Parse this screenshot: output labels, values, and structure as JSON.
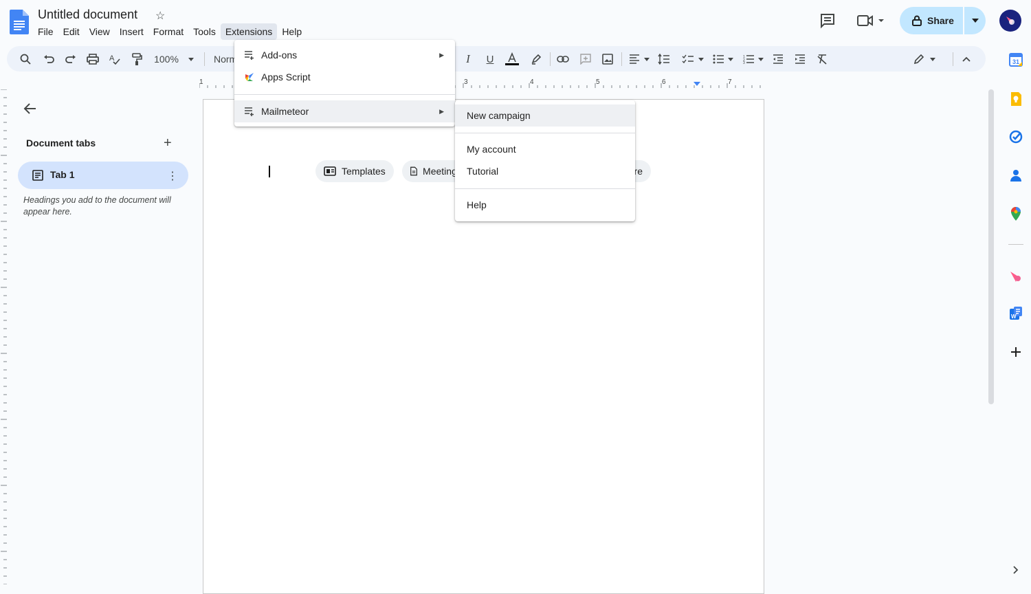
{
  "app": {
    "title": "Untitled document",
    "menus": [
      "File",
      "Edit",
      "View",
      "Insert",
      "Format",
      "Tools",
      "Extensions",
      "Help"
    ],
    "share_label": "Share"
  },
  "toolbar": {
    "zoom": "100%",
    "style": "Normal text"
  },
  "ruler": {
    "numbers": [
      "1",
      "1",
      "2",
      "3",
      "4",
      "5",
      "6",
      "7"
    ]
  },
  "left_panel": {
    "heading": "Document tabs",
    "tab_label": "Tab 1",
    "hint": "Headings you add to the document will appear here."
  },
  "chips": {
    "templates": "Templates",
    "meeting": "Meeting notes",
    "more": "More"
  },
  "extensions_menu": {
    "items": [
      {
        "label": "Add-ons",
        "icon": "addons-icon",
        "has_submenu": true
      },
      {
        "label": "Apps Script",
        "icon": "apps-script-icon",
        "has_submenu": false
      },
      {
        "label": "Mailmeteor",
        "icon": "addon-list-icon",
        "has_submenu": true
      }
    ]
  },
  "mailmeteor_submenu": {
    "items": [
      "New campaign",
      "My account",
      "Tutorial",
      "Help"
    ]
  },
  "colors": {
    "accent_blue": "#0b57d0",
    "share_bg": "#c2e7ff",
    "tab_bg": "#d3e3fd",
    "toolbar_bg": "#edf2fa"
  }
}
